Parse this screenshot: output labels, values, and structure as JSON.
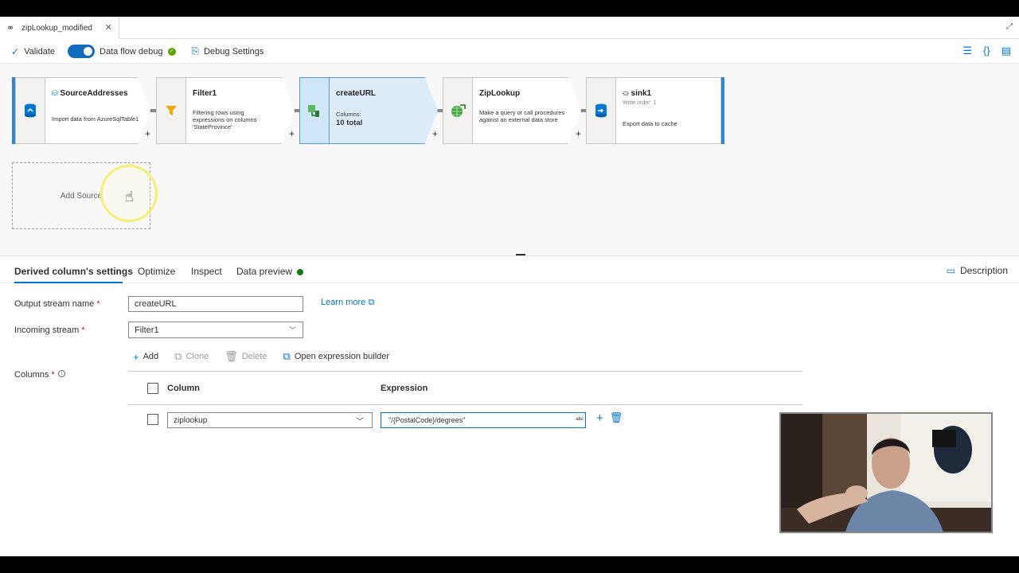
{
  "tab": {
    "title": "zipLookup_modified"
  },
  "toolbar": {
    "validate": "Validate",
    "debug_toggle": "Data flow debug",
    "debug_settings": "Debug Settings"
  },
  "canvas": {
    "nodes": [
      {
        "title": "SourceAddresses",
        "desc": "Import data from AzureSqlTable1"
      },
      {
        "title": "Filter1",
        "desc": "Filtering rows using expressions on columns 'StateProvince'"
      },
      {
        "title": "createURL",
        "meta_label": "Columns:",
        "meta_value": "10 total"
      },
      {
        "title": "ZipLookup",
        "desc": "Make a query or call procedures against an external data store"
      },
      {
        "title": "sink1",
        "subtitle": "Write order: 1",
        "desc": "Export data to cache"
      }
    ],
    "add_source": "Add Source"
  },
  "props": {
    "tabs": [
      "Derived column's settings",
      "Optimize",
      "Inspect",
      "Data preview"
    ],
    "description": "Description",
    "output_stream_label": "Output stream name",
    "output_stream_value": "createURL",
    "learn_more": "Learn more",
    "incoming_stream_label": "Incoming stream",
    "incoming_stream_value": "Filter1",
    "columns_label": "Columns",
    "commands": {
      "add": "Add",
      "clone": "Clone",
      "delete": "Delete",
      "open_builder": "Open expression builder"
    },
    "grid": {
      "col_header": "Column",
      "expr_header": "Expression",
      "rows": [
        {
          "column": "ziplookup",
          "expression": "\"/{PostalCode}/degrees\""
        }
      ]
    },
    "required_marker": "*",
    "abc": "abc"
  }
}
